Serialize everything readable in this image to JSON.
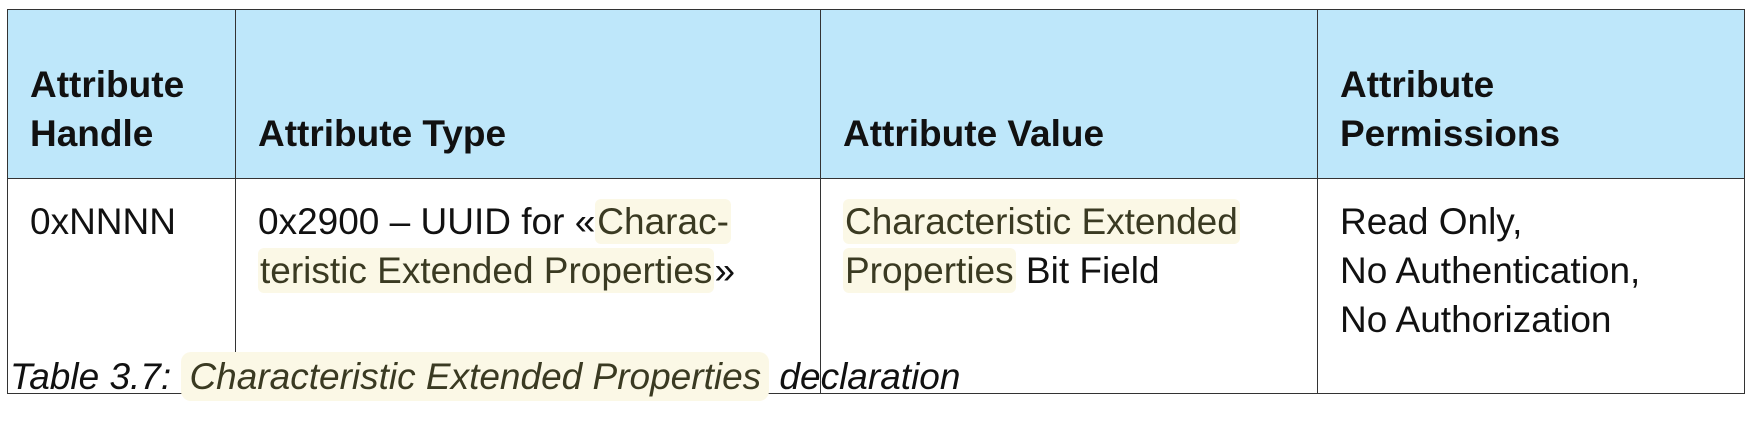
{
  "table": {
    "headers": [
      {
        "line1": "Attribute",
        "line2": "Handle"
      },
      {
        "line1": "",
        "line2": "Attribute Type"
      },
      {
        "line1": "",
        "line2": "Attribute Value"
      },
      {
        "line1": "Attribute",
        "line2": "Permissions"
      }
    ],
    "row": {
      "handle": "0xNNNN",
      "type_prefix": "0x2900 – UUID for «",
      "type_highlight_1": "Charac-",
      "type_highlight_2": "teristic Extended Properties",
      "type_suffix": "»",
      "value_highlight_1": "Characteristic Extended",
      "value_highlight_2": "Properties",
      "value_suffix": " Bit Field",
      "permissions": [
        "Read Only,",
        "No Authentication,",
        "No Authorization"
      ]
    }
  },
  "caption": {
    "prefix": "Table 3.7: ",
    "highlight": "Characteristic Extended Properties",
    "suffix": " declaration"
  },
  "colors": {
    "header_bg": "#bee7fa",
    "highlight_bg": "#fbf8e6",
    "border": "#333333"
  }
}
